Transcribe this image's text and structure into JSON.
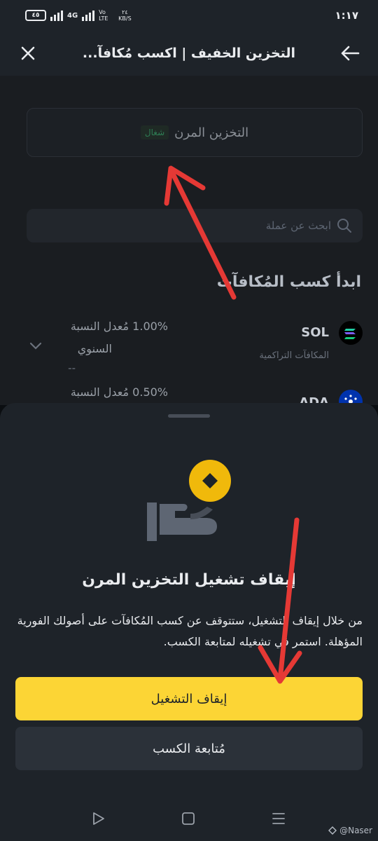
{
  "status_bar": {
    "battery": "٤٥",
    "network": "4G",
    "volte": "Vo LTE",
    "speed_value": "٢٤",
    "speed_unit": "KB/S",
    "time": "١:١٧"
  },
  "header": {
    "title": "التخزين الخفيف | اكسب مُكافآ...",
    "back_icon": "arrow-left-icon",
    "close_icon": "close-icon"
  },
  "flexible_card": {
    "title": "التخزين المرن",
    "badge": "شغال"
  },
  "search": {
    "placeholder": "ابحث عن عملة",
    "icon": "search-icon"
  },
  "section_title": "ابدأ كسب المُكافآت",
  "coins": [
    {
      "symbol": "SOL",
      "subtitle": "المكافآت التراكمية",
      "apr_value": "1.00%",
      "apr_label": "مُعدل النسبة",
      "apr_label_2": "السنوي",
      "dash": "--",
      "icon_color": "#000000"
    },
    {
      "symbol": "ADA",
      "apr_value": "0.50%",
      "apr_label": "مُعدل النسبة",
      "icon_color": "#0033ad"
    }
  ],
  "sheet": {
    "title": "إيقاف تشغيل التخزين المرن",
    "description": "من خلال إيقاف التشغيل، ستتوقف عن كسب المُكافآت على أصولك الفورية المؤهلة. استمر في تشغيله لمتابعة الكسب.",
    "primary_button": "إيقاف التشغيل",
    "secondary_button": "مُتابعة الكسب"
  },
  "watermark": "@Naser",
  "colors": {
    "accent": "#fcd535",
    "background": "#1e2329",
    "annotation": "#e53935"
  }
}
